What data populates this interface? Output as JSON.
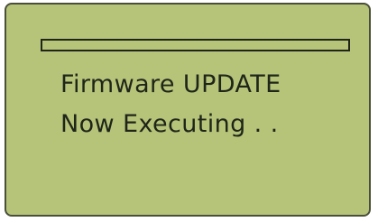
{
  "display": {
    "progress": 0,
    "line1": "Firmware UPDATE",
    "line2": "Now Executing . ."
  },
  "colors": {
    "screen_background": "#b6c47a",
    "text": "#1f2518",
    "bezel": "#4a4f3a"
  }
}
